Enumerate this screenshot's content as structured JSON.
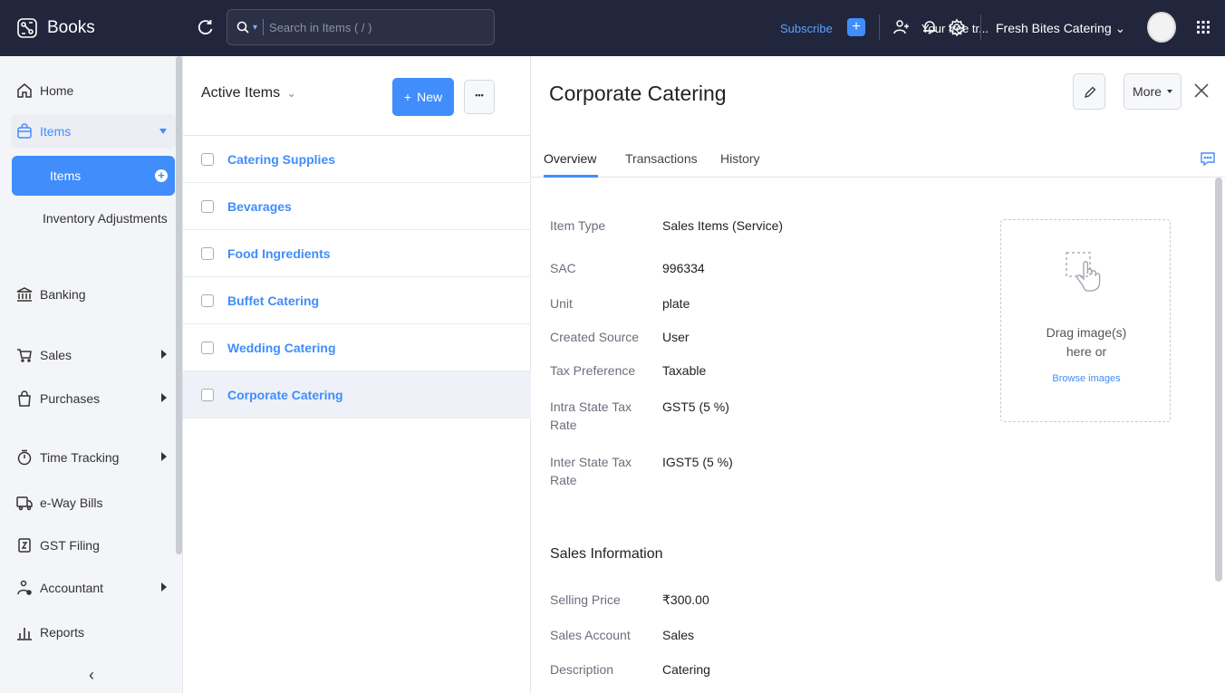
{
  "app": {
    "name": "Books"
  },
  "topbar": {
    "search_placeholder": "Search in Items ( / )",
    "trial_text": "Your free tr...",
    "subscribe_label": "Subscribe",
    "org_name": "Fresh Bites Catering",
    "org_caret": "⌄"
  },
  "sidebar": {
    "home": "Home",
    "items_parent": "Items",
    "items_sub": "Items",
    "inventory_adjustments": "Inventory Adjustments",
    "banking": "Banking",
    "sales": "Sales",
    "purchases": "Purchases",
    "time_tracking": "Time Tracking",
    "eway_bills": "e-Way Bills",
    "gst_filing": "GST Filing",
    "accountant": "Accountant",
    "reports": "Reports",
    "collapse_glyph": "‹"
  },
  "list": {
    "title": "Active Items",
    "title_caret": "⌄",
    "new_label": "New",
    "new_plus": "+",
    "more_glyph": "•••",
    "items": [
      {
        "name": "Catering Supplies"
      },
      {
        "name": "Bevarages"
      },
      {
        "name": "Food Ingredients"
      },
      {
        "name": "Buffet Catering"
      },
      {
        "name": "Wedding Catering"
      },
      {
        "name": "Corporate Catering"
      }
    ]
  },
  "detail": {
    "title": "Corporate Catering",
    "more_label": "More",
    "tabs": [
      "Overview",
      "Transactions",
      "History"
    ],
    "fields": {
      "item_type_label": "Item Type",
      "item_type_value": "Sales Items (Service)",
      "sac_label": "SAC",
      "sac_value": "996334",
      "unit_label": "Unit",
      "unit_value": "plate",
      "created_source_label": "Created Source",
      "created_source_value": "User",
      "tax_pref_label": "Tax Preference",
      "tax_pref_value": "Taxable",
      "intra_label": "Intra State Tax Rate",
      "intra_value": "GST5 (5 %)",
      "inter_label": "Inter State Tax Rate",
      "inter_value": "IGST5 (5 %)"
    },
    "sales_section_title": "Sales Information",
    "sales": {
      "selling_price_label": "Selling Price",
      "selling_price_value": "₹300.00",
      "sales_account_label": "Sales Account",
      "sales_account_value": "Sales",
      "description_label": "Description",
      "description_value": "Catering"
    },
    "dropzone": {
      "text_line1": "Drag image(s)",
      "text_line2": "here or",
      "link": "Browse images"
    }
  },
  "colors": {
    "topbar_bg": "#21263c",
    "accent": "#408dfb",
    "sidebar_bg": "#f4f5f8"
  }
}
